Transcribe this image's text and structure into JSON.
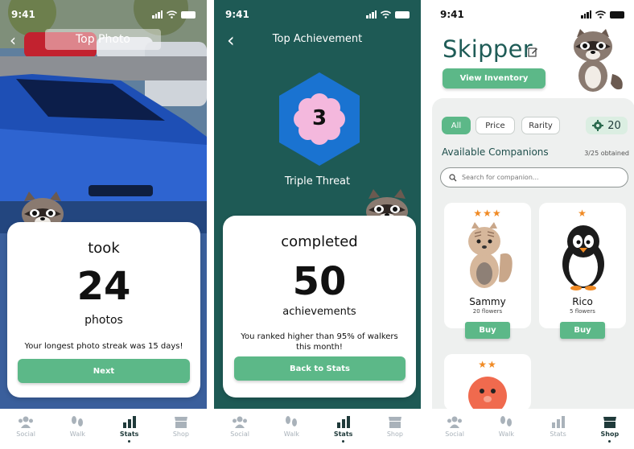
{
  "screens": {
    "top_photo": {
      "time": "9:41",
      "title": "Top Photo",
      "word_top": "took",
      "number": "24",
      "word_bottom": "photos",
      "note": "Your longest photo streak was 15 days!",
      "button": "Next"
    },
    "top_achievement": {
      "time": "9:41",
      "title": "Top Achievement",
      "badge_value": "3",
      "badge_name": "Triple Threat",
      "word_top": "completed",
      "number": "50",
      "word_bottom": "achievements",
      "note": "You ranked higher than 95% of walkers this month!",
      "button": "Back to Stats"
    },
    "shop": {
      "time": "9:41",
      "name": "Skipper",
      "inventory_button": "View Inventory",
      "filters": [
        "All",
        "Price",
        "Rarity"
      ],
      "coins": "20",
      "section_title": "Available Companions",
      "obtained": "3/25 obtained",
      "search_placeholder": "Search for companion...",
      "companions": [
        {
          "name": "Sammy",
          "price": "20 flowers",
          "stars": "★★★",
          "button": "Buy"
        },
        {
          "name": "Rico",
          "price": "5 flowers",
          "stars": "★",
          "button": "Buy"
        },
        {
          "stars": "★★"
        }
      ]
    }
  },
  "tabs": [
    "Social",
    "Walk",
    "Stats",
    "Shop"
  ],
  "colors": {
    "accent_green": "#5cb888",
    "dark_teal": "#1e5a55",
    "hex_blue": "#1a73d1",
    "badge_pink": "#f4b8dd",
    "star_orange": "#f08a24"
  },
  "icons": [
    "back-arrow-icon",
    "edit-icon",
    "gear-coin-icon",
    "search-icon",
    "social-icon",
    "walk-icon",
    "stats-icon",
    "shop-icon",
    "raccoon-mascot"
  ]
}
